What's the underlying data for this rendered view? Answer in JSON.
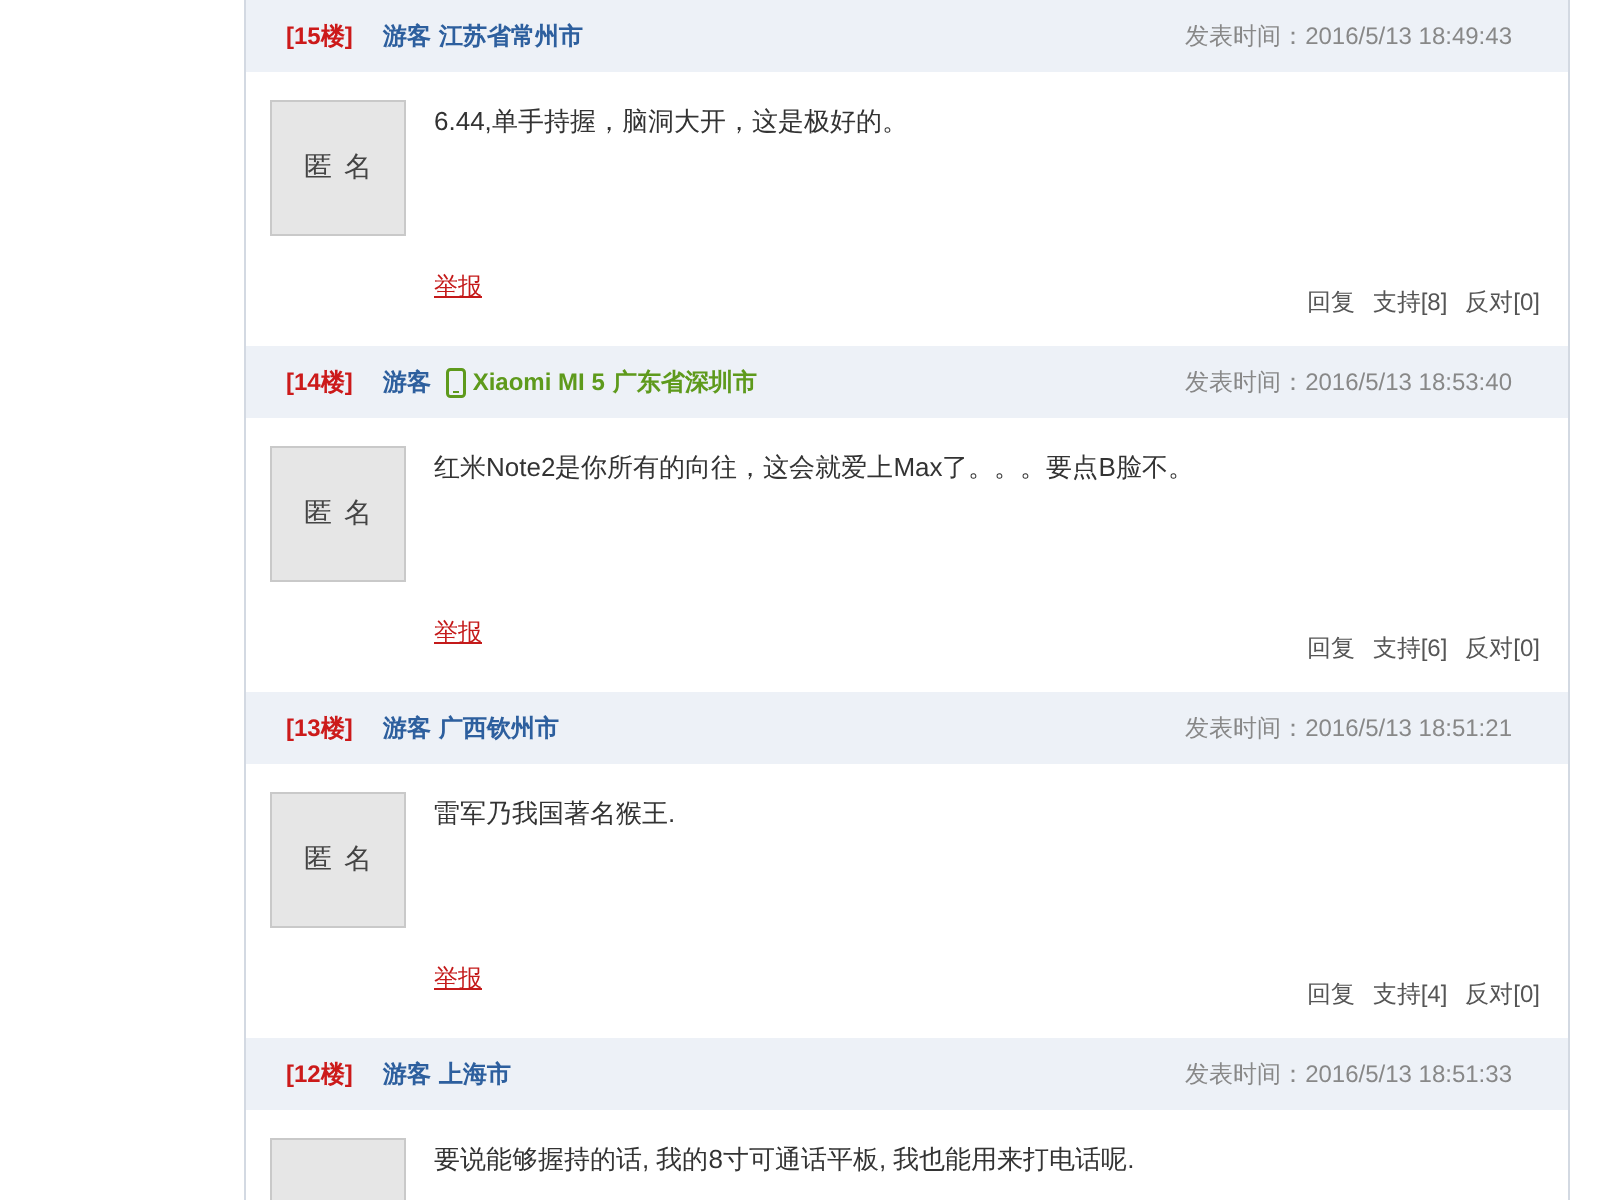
{
  "comments": [
    {
      "floor": "[15楼]",
      "user": "游客",
      "location": "江苏省常州市",
      "posted": "发表时间：2016/5/13 18:49:43",
      "avatar": "匿名",
      "text": "6.44,单手持握，脑洞大开，这是极好的。",
      "report": "举报",
      "actions": [
        "回复",
        "支持[8]",
        "反对[0]"
      ]
    },
    {
      "floor": "[14楼]",
      "user": "游客",
      "device": "Xiaomi MI 5",
      "location": "广东省深圳市",
      "posted": "发表时间：2016/5/13 18:53:40",
      "avatar": "匿名",
      "text": "红米Note2是你所有的向往，这会就爱上Max了。。。要点B脸不。",
      "report": "举报",
      "actions": [
        "回复",
        "支持[6]",
        "反对[0]"
      ]
    },
    {
      "floor": "[13楼]",
      "user": "游客",
      "location": "广西钦州市",
      "posted": "发表时间：2016/5/13 18:51:21",
      "avatar": "匿名",
      "text": "雷军乃我国著名猴王.",
      "report": "举报",
      "actions": [
        "回复",
        "支持[4]",
        "反对[0]"
      ]
    },
    {
      "floor": "[12楼]",
      "user": "游客",
      "location": "上海市",
      "posted": "发表时间：2016/5/13 18:51:33",
      "text": "要说能够握持的话, 我的8寸可通话平板, 我也能用来打电话呢."
    }
  ]
}
